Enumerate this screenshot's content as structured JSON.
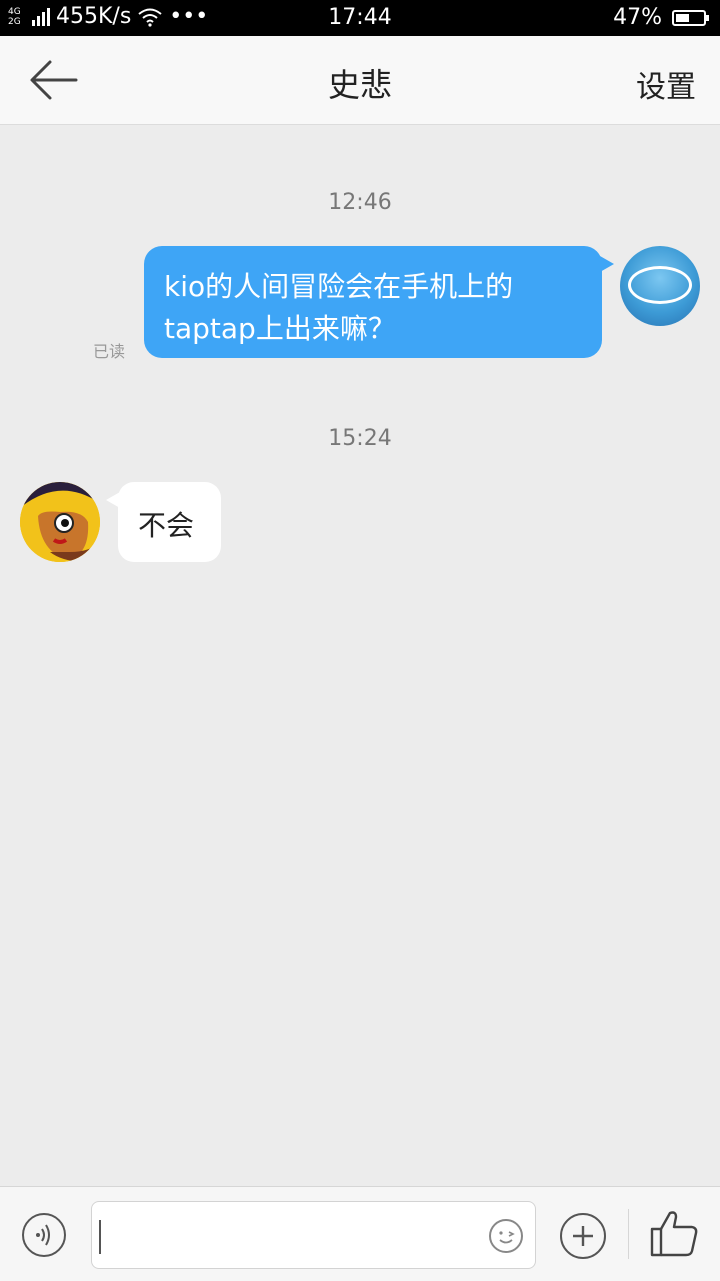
{
  "status_bar": {
    "network_top": "4G",
    "network_bottom": "2G",
    "speed": "455K/s",
    "dots": "•••",
    "time": "17:44",
    "battery": "47%",
    "battery_level": 0.47
  },
  "header": {
    "back_icon": "arrow-left-icon",
    "title": "史悲",
    "settings_label": "设置"
  },
  "chat": {
    "messages": [
      {
        "time": "12:46",
        "direction": "outgoing",
        "text_line1": "kio的人间冒险会在手机上的",
        "text_line2": "taptap上出来嘛？",
        "read_label": "已读"
      },
      {
        "time": "15:24",
        "direction": "incoming",
        "text": "不会"
      }
    ]
  },
  "input_bar": {
    "voice_icon": "voice-icon",
    "text_value": "",
    "emoji_icon": "emoji-icon",
    "plus_icon": "plus-icon",
    "like_icon": "thumbs-up-icon"
  },
  "colors": {
    "outgoing_bubble": "#3ea5f6",
    "background": "#ececec"
  }
}
